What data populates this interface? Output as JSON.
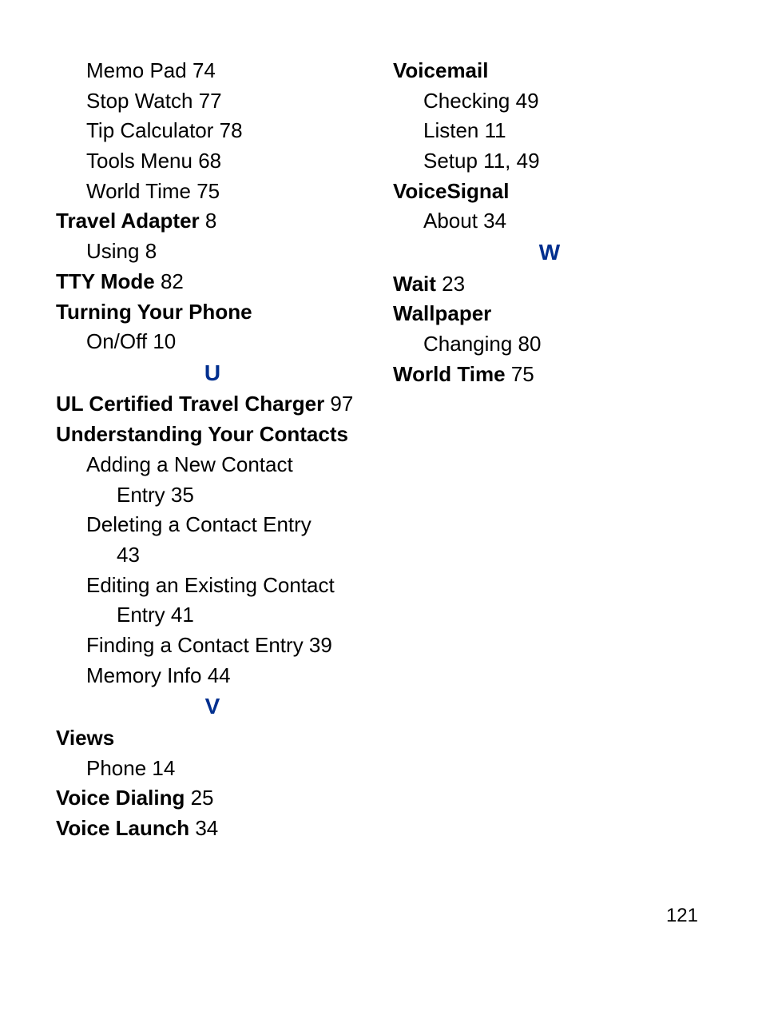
{
  "page_number": "121",
  "columns": [
    [
      {
        "type": "sub1",
        "text": "Memo Pad",
        "pages": [
          "74"
        ]
      },
      {
        "type": "sub1",
        "text": "Stop Watch",
        "pages": [
          "77"
        ]
      },
      {
        "type": "sub1",
        "text": "Tip Calculator",
        "pages": [
          "78"
        ]
      },
      {
        "type": "sub1",
        "text": "Tools Menu",
        "pages": [
          "68"
        ]
      },
      {
        "type": "sub1",
        "text": "World Time",
        "pages": [
          "75"
        ]
      },
      {
        "type": "top",
        "text": "Travel Adapter",
        "pages": [
          "8"
        ]
      },
      {
        "type": "sub1",
        "text": "Using",
        "pages": [
          "8"
        ]
      },
      {
        "type": "top",
        "text": "TTY Mode",
        "pages": [
          "82"
        ]
      },
      {
        "type": "top",
        "text": "Turning Your Phone"
      },
      {
        "type": "sub1",
        "text": "On/Off",
        "pages": [
          "10"
        ]
      },
      {
        "type": "letter",
        "text": "U"
      },
      {
        "type": "top",
        "text": "UL Certified Travel Charger",
        "pages": [
          "97"
        ]
      },
      {
        "type": "top",
        "text": "Understanding Your Contacts"
      },
      {
        "type": "sub1",
        "text": "Adding a New Contact"
      },
      {
        "type": "sub2",
        "text": "Entry",
        "pages": [
          "35"
        ]
      },
      {
        "type": "sub1",
        "text": "Deleting a Contact Entry"
      },
      {
        "type": "sub2",
        "text": "",
        "pages": [
          "43"
        ]
      },
      {
        "type": "sub1",
        "text": "Editing an Existing Contact"
      },
      {
        "type": "sub2",
        "text": "Entry",
        "pages": [
          "41"
        ]
      },
      {
        "type": "sub1",
        "text": "Finding a Contact Entry",
        "pages": [
          "39"
        ]
      },
      {
        "type": "sub1",
        "text": "Memory Info",
        "pages": [
          "44"
        ]
      },
      {
        "type": "letter",
        "text": "V"
      },
      {
        "type": "top",
        "text": "Views"
      },
      {
        "type": "sub1",
        "text": "Phone",
        "pages": [
          "14"
        ]
      },
      {
        "type": "top",
        "text": "Voice Dialing",
        "pages": [
          "25"
        ]
      },
      {
        "type": "top",
        "text": "Voice Launch",
        "pages": [
          "34"
        ]
      }
    ],
    [
      {
        "type": "top",
        "text": "Voicemail"
      },
      {
        "type": "sub1",
        "text": "Checking",
        "pages": [
          "49"
        ]
      },
      {
        "type": "sub1",
        "text": "Listen",
        "pages": [
          "11"
        ]
      },
      {
        "type": "sub1",
        "text": "Setup",
        "pages": [
          "11",
          "49"
        ]
      },
      {
        "type": "top",
        "text": "VoiceSignal"
      },
      {
        "type": "sub1",
        "text": "About",
        "pages": [
          "34"
        ]
      },
      {
        "type": "letter",
        "text": "W"
      },
      {
        "type": "top",
        "text": "Wait",
        "pages": [
          "23"
        ]
      },
      {
        "type": "top",
        "text": "Wallpaper"
      },
      {
        "type": "sub1",
        "text": "Changing",
        "pages": [
          "80"
        ]
      },
      {
        "type": "top",
        "text": "World Time",
        "pages": [
          "75"
        ]
      }
    ]
  ]
}
